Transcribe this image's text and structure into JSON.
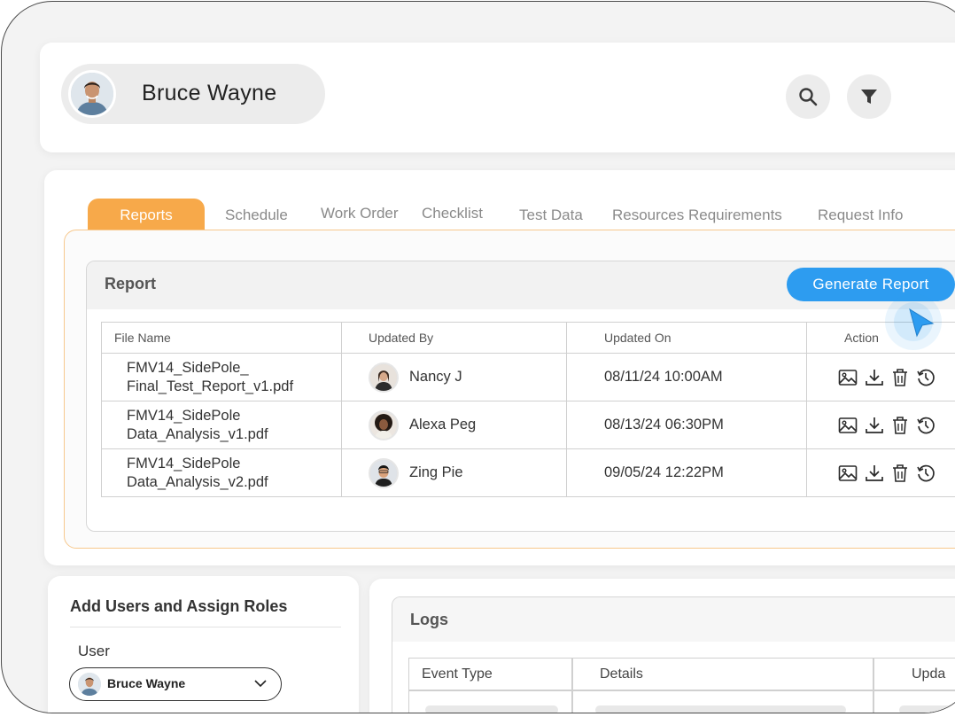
{
  "header": {
    "user_name": "Bruce Wayne"
  },
  "tabs": [
    {
      "label": "Reports",
      "active": true
    },
    {
      "label": "Schedule"
    },
    {
      "label": "Work Order"
    },
    {
      "label": "Checklist"
    },
    {
      "label": "Test Data"
    },
    {
      "label": "Resources Requirements"
    },
    {
      "label": "Request Info"
    }
  ],
  "report": {
    "title": "Report",
    "generate_label": "Generate Report",
    "columns": [
      "File Name",
      "Updated By",
      "Updated On",
      "Action"
    ],
    "rows": [
      {
        "file_line1": "FMV14_SidePole_",
        "file_line2": "Final_Test_Report_v1.pdf",
        "updated_by": "Nancy J",
        "updated_on": "08/11/24 10:00AM"
      },
      {
        "file_line1": "FMV14_SidePole",
        "file_line2": "Data_Analysis_v1.pdf",
        "updated_by": "Alexa Peg",
        "updated_on": "08/13/24  06:30PM"
      },
      {
        "file_line1": "FMV14_SidePole",
        "file_line2": "Data_Analysis_v2.pdf",
        "updated_by": "Zing Pie",
        "updated_on": "09/05/24  12:22PM"
      }
    ],
    "action_icons": [
      "image-icon",
      "download-icon",
      "trash-icon",
      "history-icon"
    ]
  },
  "users": {
    "title": "Add Users and Assign Roles",
    "user_label": "User",
    "selected_user": "Bruce Wayne"
  },
  "logs": {
    "title": "Logs",
    "columns": [
      "Event Type",
      "Details",
      "Upda"
    ]
  },
  "colors": {
    "accent_orange": "#f7a94a",
    "accent_blue": "#2d9cf0"
  }
}
